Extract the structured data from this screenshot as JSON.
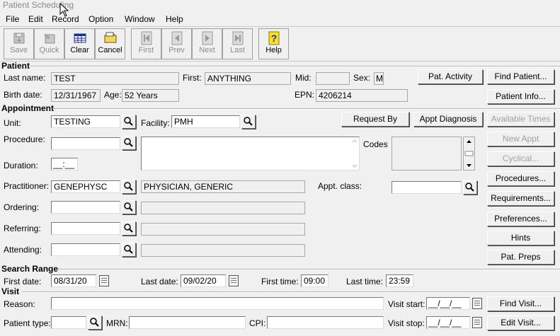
{
  "window": {
    "title": "Patient Scheduling"
  },
  "menu": [
    "File",
    "Edit",
    "Record",
    "Option",
    "Window",
    "Help"
  ],
  "toolbar": [
    {
      "label": "Save",
      "icon": "save-icon",
      "enabled": false
    },
    {
      "label": "Quick",
      "icon": "quick-icon",
      "enabled": false
    },
    {
      "label": "Clear",
      "icon": "clear-icon",
      "enabled": true
    },
    {
      "label": "Cancel",
      "icon": "cancel-icon",
      "enabled": true
    },
    {
      "label": "First",
      "icon": "first-icon",
      "enabled": false
    },
    {
      "label": "Prev",
      "icon": "prev-icon",
      "enabled": false
    },
    {
      "label": "Next",
      "icon": "next-icon",
      "enabled": false
    },
    {
      "label": "Last",
      "icon": "last-icon",
      "enabled": false
    },
    {
      "label": "Help",
      "icon": "help-icon",
      "enabled": true
    }
  ],
  "patient": {
    "section": "Patient",
    "last_name_label": "Last name:",
    "last_name": "TEST",
    "first_label": "First:",
    "first": "ANYTHING",
    "mid_label": "Mid:",
    "mid": "",
    "sex_label": "Sex:",
    "sex": "M",
    "birth_label": "Birth date:",
    "birth": "12/31/1967",
    "age_label": "Age:",
    "age": "52 Years",
    "epn_label": "EPN:",
    "epn": "4206214",
    "activity_btn": "Pat. Activity",
    "find_btn": "Find Patient...",
    "info_btn": "Patient Info..."
  },
  "appointment": {
    "section": "Appointment",
    "unit_label": "Unit:",
    "unit": "TESTING",
    "facility_label": "Facility:",
    "facility": "PMH",
    "request_btn": "Request By",
    "diag_btn": "Appt Diagnosis",
    "available_btn": "Available Times",
    "procedure_label": "Procedure:",
    "procedure": "",
    "codes_label": "Codes",
    "duration_label": "Duration:",
    "duration": "__:__",
    "practitioner_label": "Practitioner:",
    "practitioner": "GENEPHYSC",
    "practitioner_name": "PHYSICIAN, GENERIC",
    "class_label": "Appt. class:",
    "class_value": "",
    "ordering_label": "Ordering:",
    "referring_label": "Referring:",
    "attending_label": "Attending:",
    "side_buttons": [
      {
        "label": "New Appt",
        "enabled": false
      },
      {
        "label": "Cyclical...",
        "enabled": false
      },
      {
        "label": "Procedures...",
        "enabled": true
      },
      {
        "label": "Requirements...",
        "enabled": true
      },
      {
        "label": "Preferences...",
        "enabled": true
      },
      {
        "label": "Hints",
        "enabled": true
      },
      {
        "label": "Pat. Preps",
        "enabled": true
      }
    ]
  },
  "search_range": {
    "section": "Search Range",
    "first_date_label": "First date:",
    "first_date": "08/31/20",
    "last_date_label": "Last date:",
    "last_date": "09/02/20",
    "first_time_label": "First time:",
    "first_time": "09:00",
    "last_time_label": "Last time:",
    "last_time": "23:59"
  },
  "visit": {
    "section": "Visit",
    "reason_label": "Reason:",
    "reason": "",
    "visit_start_label": "Visit start:",
    "visit_start": "__/__/__",
    "visit_stop_label": "Visit stop:",
    "visit_stop": "__/__/__",
    "patient_type_label": "Patient type:",
    "patient_type": "",
    "mrn_label": "MRN:",
    "mrn": "",
    "cpi_label": "CPI:",
    "cpi": "",
    "find_btn": "Find Visit...",
    "edit_btn": "Edit Visit..."
  }
}
